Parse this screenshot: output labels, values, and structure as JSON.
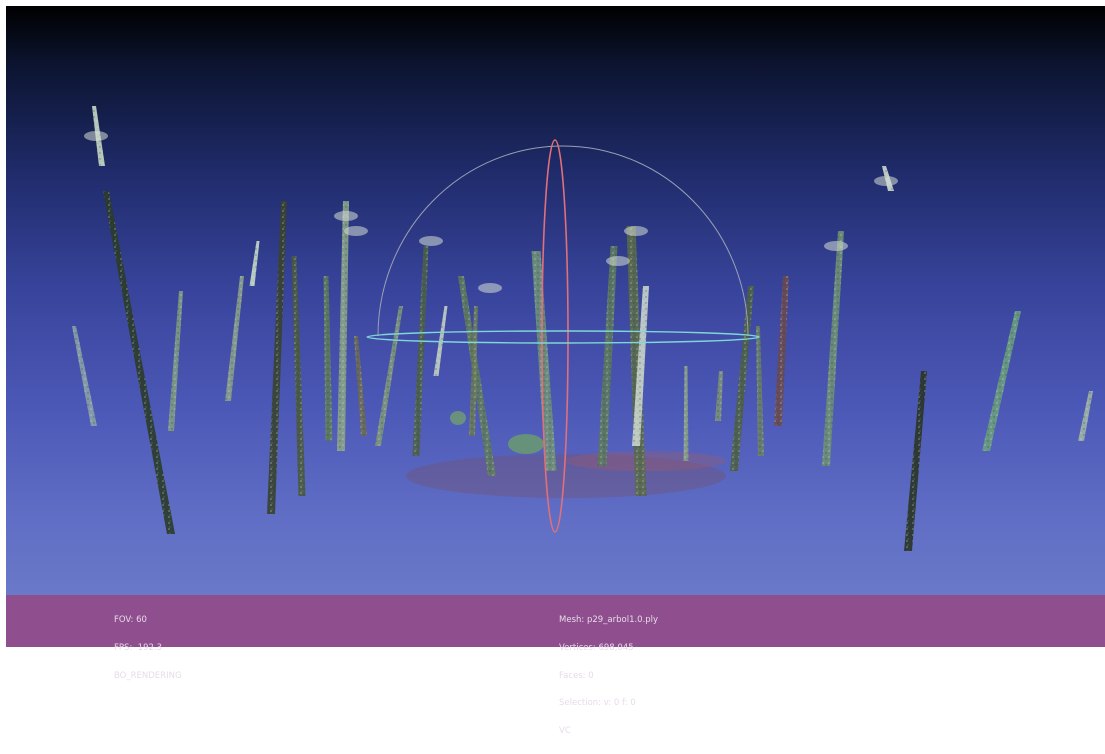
{
  "viewer": {
    "scene": "point-cloud",
    "trackball": {
      "ring_colors": {
        "vertical": "#e0707a",
        "horizontal": "#7fd6d6",
        "arc": "#9aa0b4"
      }
    },
    "background_gradient": {
      "top": "#000000",
      "bottom": "#6a79c8"
    }
  },
  "status": {
    "bar_color": "#8f4f8f",
    "left": {
      "fov": "FOV: 60",
      "fps": "FPS:  192.3",
      "mode": "BO_RENDERING"
    },
    "right": {
      "mesh": "Mesh: p29_arbol1.0.ply",
      "vertices": "Vertices: 698,045",
      "faces": "Faces: 0",
      "selection": "Selection: v: 0 f: 0",
      "vc": "VC"
    }
  }
}
